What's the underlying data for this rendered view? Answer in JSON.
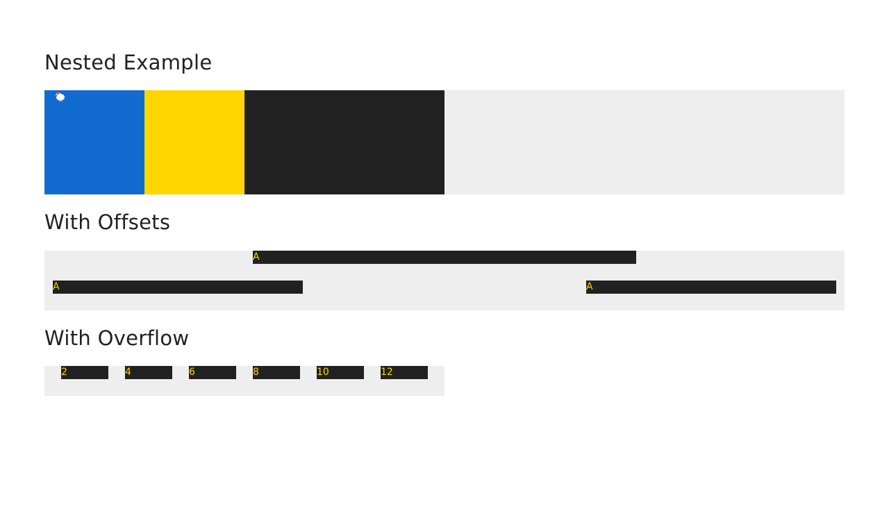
{
  "sections": {
    "nested": {
      "title": "Nested Example",
      "colors": {
        "blue": "#126bcf",
        "yellow": "#ffd600",
        "black": "#212121",
        "panel": "#eeeeee"
      },
      "icon": "chicken-icon"
    },
    "offsets": {
      "title": "With Offsets",
      "top_item": "A",
      "left_item": "A",
      "right_item": "A"
    },
    "overflow": {
      "title": "With Overflow",
      "items": [
        "2",
        "4",
        "6",
        "8",
        "10",
        "12"
      ]
    }
  },
  "colors": {
    "bar_background": "#212121",
    "bar_text": "#ffd600",
    "panel": "#eeeeee",
    "heading_text": "#212121"
  }
}
